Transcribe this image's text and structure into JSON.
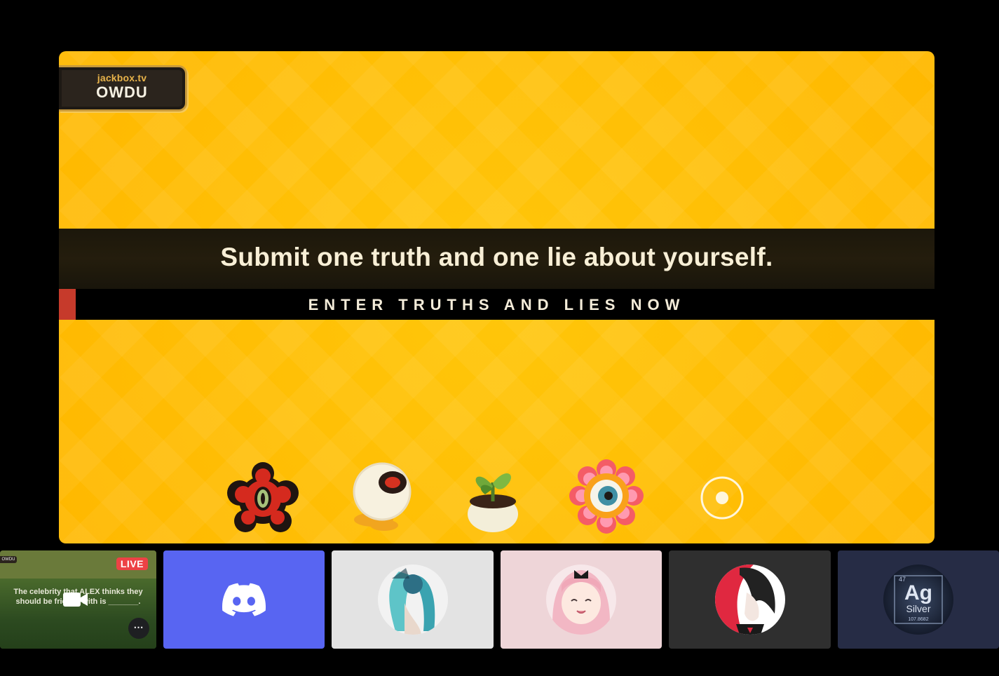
{
  "game": {
    "room_badge": {
      "site": "jackbox.tv",
      "code": "OWDU"
    },
    "prompt": "Submit one truth and one lie about yourself.",
    "instruction": "ENTER TRUTHS AND LIES NOW",
    "players": [
      {
        "icon": "red-flower-eye-icon"
      },
      {
        "icon": "eyeball-icon"
      },
      {
        "icon": "sprout-pot-icon"
      },
      {
        "icon": "pink-flower-eye-icon"
      },
      {
        "icon": "empty-slot-icon"
      }
    ]
  },
  "participants": {
    "stream": {
      "live_label": "LIVE",
      "mini_badge": "OWDU",
      "caption": "The celebrity that ALEX thinks they should be friends with is _______.",
      "more_label": "⋯"
    },
    "tiles": [
      {
        "name": "discord-app",
        "color": "#5865f2"
      },
      {
        "name": "user-1",
        "color": "#e3e3e3"
      },
      {
        "name": "user-2",
        "color": "#eed5d8"
      },
      {
        "name": "user-3",
        "color": "#2f2f2f"
      },
      {
        "name": "user-4",
        "color": "#262c45"
      }
    ],
    "user4_avatar_text": {
      "symbol": "Ag",
      "label": "Silver",
      "number": "107.8682",
      "corner": "47"
    }
  }
}
